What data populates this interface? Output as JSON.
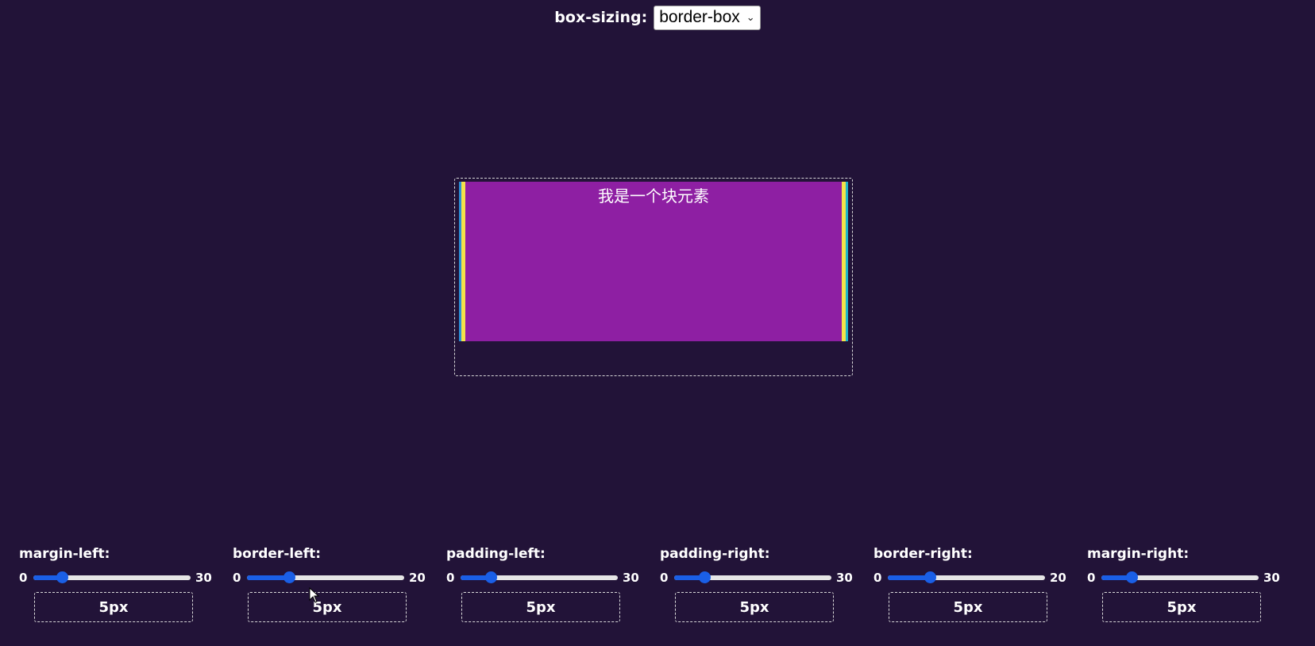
{
  "top": {
    "label": "box-sizing:",
    "select_value": "border-box"
  },
  "demo": {
    "text": "我是一个块元素"
  },
  "colors": {
    "background": "#221338",
    "content": "#8e1fa3",
    "border_stripe": "#f3e24a",
    "padding_stripe": "#1fb4c9",
    "slider_accent": "#1a5fe6"
  },
  "controls": [
    {
      "label": "margin-left:",
      "min": "0",
      "max": "30",
      "value": "5px",
      "fraction": 0.18
    },
    {
      "label": "border-left:",
      "min": "0",
      "max": "20",
      "value": "5px",
      "fraction": 0.27
    },
    {
      "label": "padding-left:",
      "min": "0",
      "max": "30",
      "value": "5px",
      "fraction": 0.19
    },
    {
      "label": "padding-right:",
      "min": "0",
      "max": "30",
      "value": "5px",
      "fraction": 0.19
    },
    {
      "label": "border-right:",
      "min": "0",
      "max": "20",
      "value": "5px",
      "fraction": 0.27
    },
    {
      "label": "margin-right:",
      "min": "0",
      "max": "30",
      "value": "5px",
      "fraction": 0.19
    }
  ]
}
